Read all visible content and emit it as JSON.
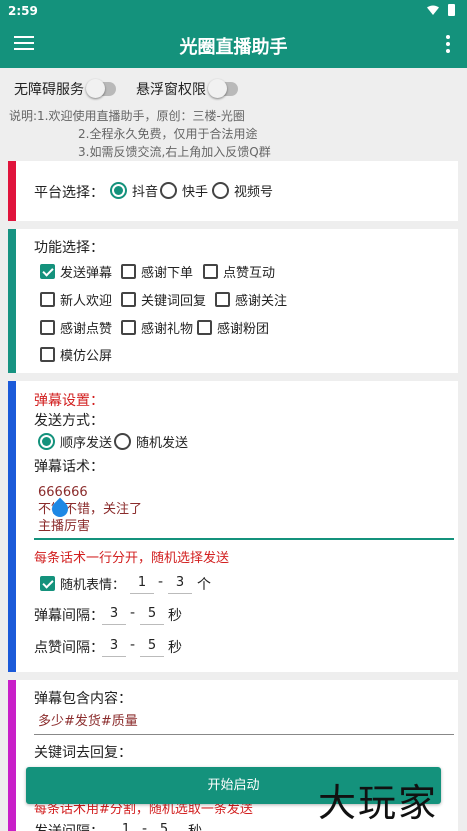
{
  "status": {
    "time": "2:59"
  },
  "appbar": {
    "title": "光圈直播助手"
  },
  "toggles": [
    {
      "label": "无障碍服务",
      "on": false
    },
    {
      "label": "悬浮窗权限",
      "on": false
    }
  ],
  "info": {
    "line1": "说明:1.欢迎使用直播助手，原创：三楼-光圈",
    "line2": "2.全程永久免费，仅用于合法用途",
    "line3": "3.如需反馈交流,右上角加入反馈Q群"
  },
  "platform": {
    "label": "平台选择：",
    "options": [
      "抖音",
      "快手",
      "视频号"
    ],
    "selected": "抖音"
  },
  "functions": {
    "label": "功能选择：",
    "items": [
      {
        "label": "发送弹幕",
        "checked": true
      },
      {
        "label": "感谢下单",
        "checked": false
      },
      {
        "label": "点赞互动",
        "checked": false
      },
      {
        "label": "新人欢迎",
        "checked": false
      },
      {
        "label": "关键词回复",
        "checked": false
      },
      {
        "label": "感谢关注",
        "checked": false
      },
      {
        "label": "感谢点赞",
        "checked": false
      },
      {
        "label": "感谢礼物",
        "checked": false
      },
      {
        "label": "感谢粉团",
        "checked": false
      },
      {
        "label": "模仿公屏",
        "checked": false
      }
    ]
  },
  "danmu": {
    "section_title": "弹幕设置：",
    "send_mode_label": "发送方式：",
    "send_modes": [
      "顺序发送",
      "随机发送"
    ],
    "send_mode_selected": "顺序发送",
    "phrases_label": "弹幕话术：",
    "phrases": [
      "666666",
      "不错不错，关注了",
      "主播厉害"
    ],
    "hint": "每条话术一行分开，随机选择发送",
    "emoji_label": "随机表情：",
    "emoji_checked": true,
    "emoji_min": "1",
    "emoji_max": "3",
    "emoji_unit": "个",
    "interval_label": "弹幕间隔：",
    "interval_min": "3",
    "interval_max": "5",
    "interval_unit": "秒",
    "like_label": "点赞间隔：",
    "like_min": "3",
    "like_max": "5",
    "like_unit": "秒",
    "dash": "-"
  },
  "keyword": {
    "contains_label": "弹幕包含内容：",
    "contains_value": "多少#发货#质量",
    "reply_label": "关键词去回复：",
    "hint": "每条话术用#分割，随机选取一条发送",
    "interval_label": "发送间隔：",
    "interval_min": "1",
    "interval_max": "5",
    "interval_unit": "秒"
  },
  "start_button": "开始启动",
  "watermark": "大玩家"
}
